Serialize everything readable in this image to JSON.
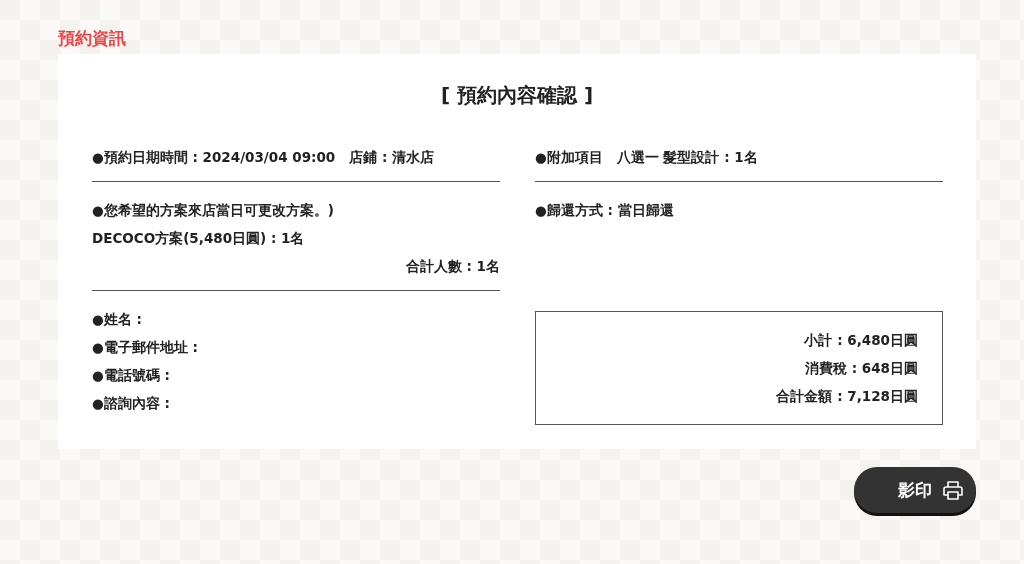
{
  "page_title": "預約資訊",
  "heading": "[ 預約內容確認 ]",
  "reservation": {
    "datetime": "●預約日期時間 : 2024/03/04 09:00",
    "store": "店鋪 : 清水店"
  },
  "plan": {
    "label": "●您希望的方案來店當日可更改方案。)",
    "item": "DECOCO方案(5,480日圓) : 1名",
    "total": "合計人數 : 1名"
  },
  "contact": [
    "●姓名 :",
    "●電子郵件地址 :",
    "●電話號碼 :",
    "●諮詢內容 :"
  ],
  "options": "●附加項目　八選一 髮型設計 : 1名",
  "return_method": "●歸還方式 : 當日歸還",
  "totals": [
    "小計 : 6,480日圓",
    "消費稅 : 648日圓",
    "合計金額 : 7,128日圓"
  ],
  "print_button": "影印"
}
